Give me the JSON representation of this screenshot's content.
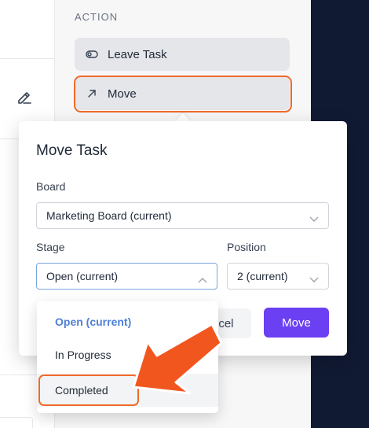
{
  "action_panel": {
    "heading": "ACTION",
    "leave_label": "Leave Task",
    "move_label": "Move"
  },
  "modal": {
    "title": "Move Task",
    "board_label": "Board",
    "board_value": "Marketing Board (current)",
    "stage_label": "Stage",
    "stage_value": "Open (current)",
    "position_label": "Position",
    "position_value": "2 (current)",
    "cancel_label": "ncel",
    "move_label": "Move"
  },
  "stage_dropdown": {
    "options": [
      "Open (current)",
      "In Progress",
      "Completed"
    ]
  },
  "colors": {
    "accent": "#6b3ff2",
    "highlight": "#f06a2a",
    "selected_text": "#4f7fd6",
    "dark_sidebar": "#111a33"
  },
  "icons": {
    "left_tool": "edit-pencil-icon",
    "leave": "toggle-icon",
    "move": "arrow-up-right-icon",
    "chevron": "chevron-down-icon"
  }
}
